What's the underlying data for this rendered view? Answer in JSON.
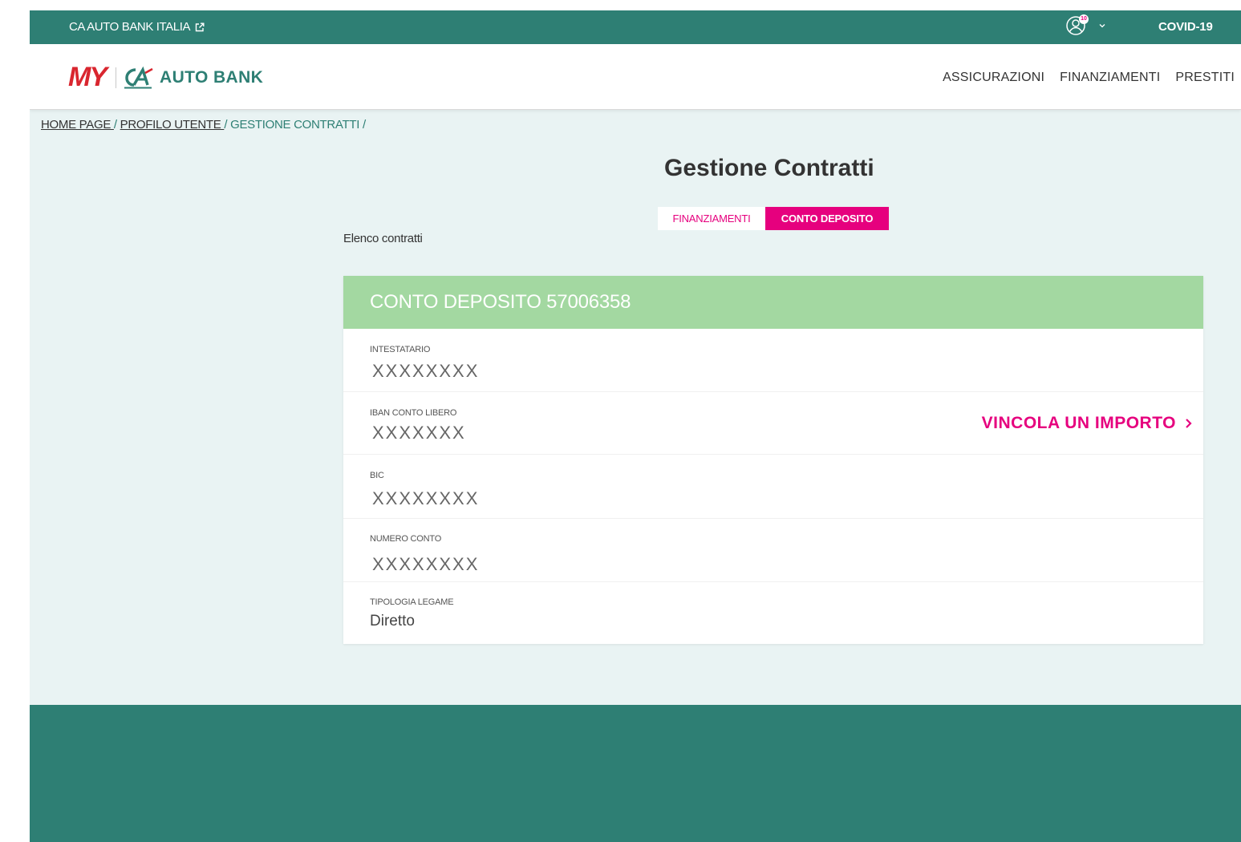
{
  "topbar": {
    "brand_link": "CA AUTO BANK ITALIA",
    "notification_count": "10",
    "covid_link": "COVID-19"
  },
  "header": {
    "logo_my": "MY",
    "logo_text": "AUTO BANK",
    "nav": [
      "ASSICURAZIONI",
      "FINANZIAMENTI",
      "PRESTITI"
    ]
  },
  "breadcrumb": {
    "home": "HOME PAGE ",
    "profile": "PROFILO UTENTE ",
    "current": "GESTIONE CONTRATTI /",
    "sep": " / "
  },
  "page": {
    "title": "Gestione Contratti",
    "tabs": [
      {
        "label": "FINANZIAMENTI",
        "active": false
      },
      {
        "label": "CONTO DEPOSITO",
        "active": true
      }
    ],
    "list_label": "Elenco contratti"
  },
  "card": {
    "title": "CONTO DEPOSITO 57006358",
    "rows": [
      {
        "label": "INTESTATARIO",
        "value": "XXXXXXXX"
      },
      {
        "label": "IBAN CONTO LIBERO",
        "value": "XXXXXXX"
      },
      {
        "label": "BIC",
        "value": "XXXXXXXX"
      },
      {
        "label": "NUMERO CONTO",
        "value": "XXXXXXXX"
      },
      {
        "label": "TIPOLOGIA LEGAME",
        "value": "Diretto"
      }
    ],
    "cta": "VINCOLA UN IMPORTO"
  },
  "colors": {
    "brand_green": "#2e7f74",
    "card_header_green": "#a3d8a1",
    "accent_magenta": "#e6007e",
    "page_bg": "#e9f3f3",
    "logo_red": "#d9262f"
  }
}
